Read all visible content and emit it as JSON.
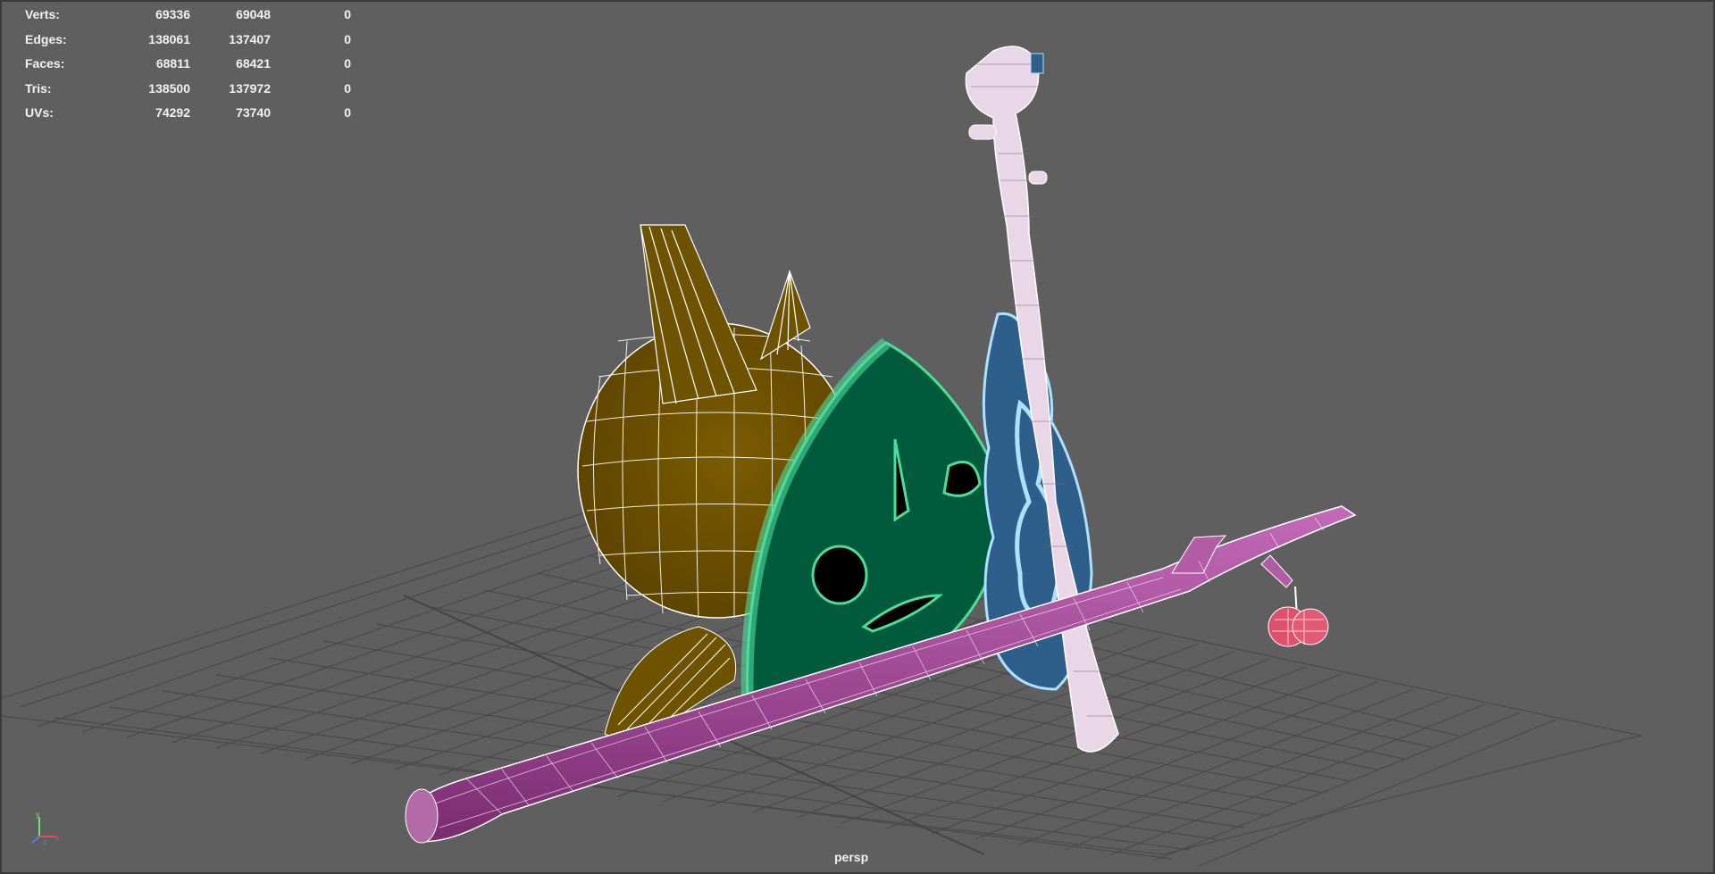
{
  "hud": {
    "rows": [
      {
        "label": "Verts:",
        "v1": "69336",
        "v2": "69048",
        "v3": "0"
      },
      {
        "label": "Edges:",
        "v1": "138061",
        "v2": "137407",
        "v3": "0"
      },
      {
        "label": "Faces:",
        "v1": "68811",
        "v2": "68421",
        "v3": "0"
      },
      {
        "label": "Tris:",
        "v1": "138500",
        "v2": "137972",
        "v3": "0"
      },
      {
        "label": "UVs:",
        "v1": "74292",
        "v2": "73740",
        "v3": "0"
      }
    ]
  },
  "camera": {
    "label": "persp"
  },
  "axis": {
    "y": "y",
    "x": "x",
    "z": "z"
  },
  "colors": {
    "background": "#5f5f5f",
    "grid": "#4e4e4e",
    "body": "#6b5000",
    "mask": "#005a3c",
    "mask_wire": "#4ddc9c",
    "body_wire": "#ffffff",
    "instrument_body": "#2e5f8a",
    "instrument_wire": "#aee0ff",
    "stick": "#a04e92",
    "berries": "#e0506a"
  }
}
